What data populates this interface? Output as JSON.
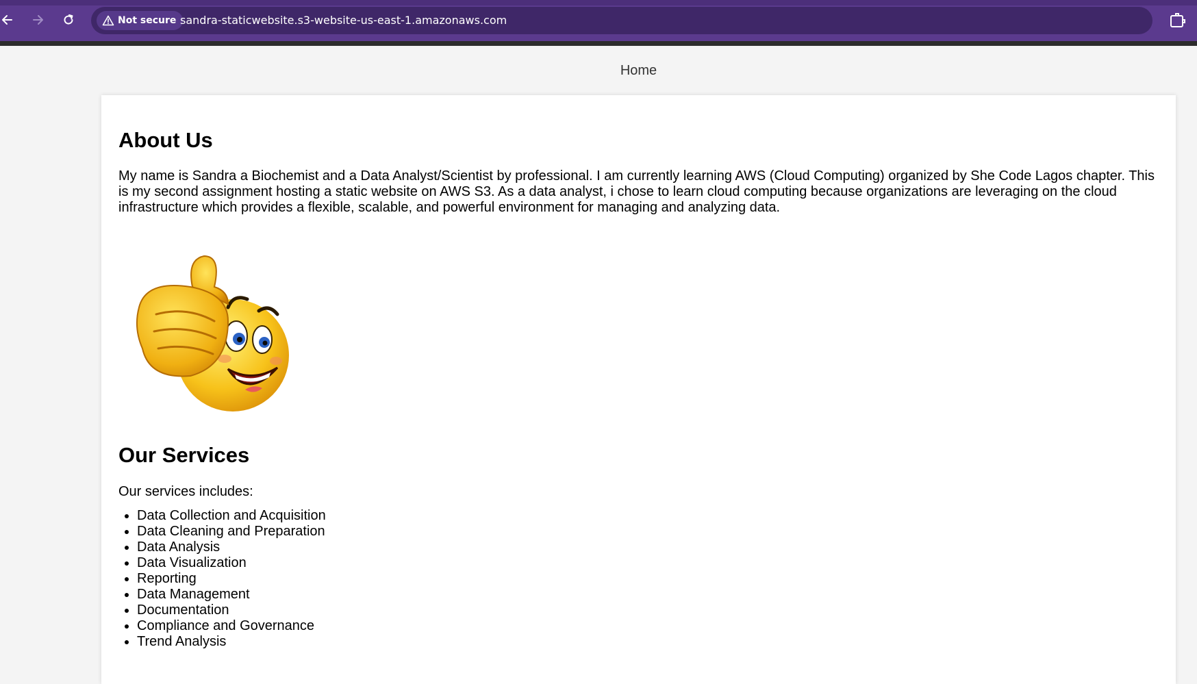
{
  "browser": {
    "security_label": "Not secure",
    "url": "sandra-staticwebsite.s3-website-us-east-1.amazonaws.com",
    "icons": [
      "back-arrow-icon",
      "forward-arrow-icon",
      "reload-icon",
      "warning-triangle-icon",
      "star-icon",
      "extensions-icon"
    ],
    "colors": {
      "toolbar": "#5b3a8e",
      "omnibox": "#3f2768"
    }
  },
  "nav": {
    "home_label": "Home"
  },
  "about": {
    "title": "About Us",
    "text": "My name is Sandra a Biochemist and a Data Analyst/Scientist by professional. I am currently learning AWS (Cloud Computing) organized by She Code Lagos chapter. This is my second assignment hosting a static website on AWS S3. As a data analyst, i chose to learn cloud computing because organizations are leveraging on the cloud infrastructure which provides a flexible, scalable, and powerful environment for managing and analyzing data.",
    "image_icon": "thumbs-up-smiley-emoji"
  },
  "services": {
    "title": "Our Services",
    "intro": "Our services includes:",
    "items": [
      "Data Collection and Acquisition",
      "Data Cleaning and Preparation",
      "Data Analysis",
      "Data Visualization",
      "Reporting",
      "Data Management",
      "Documentation",
      "Compliance and Governance",
      "Trend Analysis"
    ]
  }
}
